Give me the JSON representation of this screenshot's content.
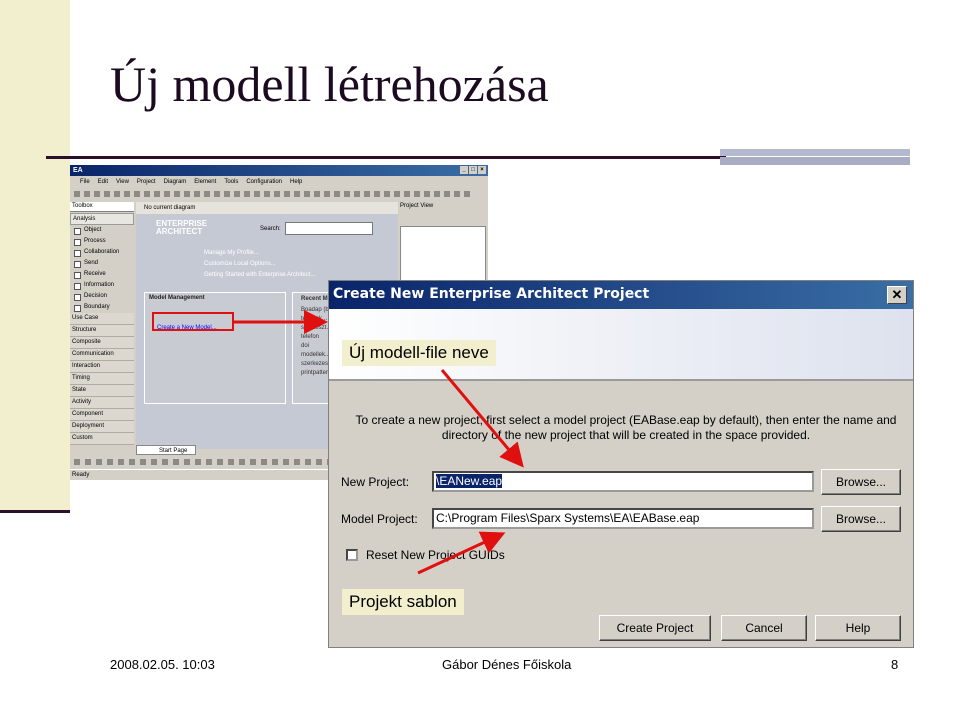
{
  "slide": {
    "title": "Új modell létrehozása",
    "footer_date": "2008.02.05. 10:03",
    "footer_center": "Gábor Dénes Főiskola",
    "page_number": "8",
    "accent_color": "#2b0f2b",
    "callout_color": "#f2efcf",
    "arrow_color": "#e01010"
  },
  "callouts": {
    "file_name": "Új modell-file neve",
    "template": "Projekt sablon"
  },
  "ea_window": {
    "title": "EA",
    "menu": [
      "File",
      "Edit",
      "View",
      "Project",
      "Diagram",
      "Element",
      "Tools",
      "Configuration",
      "Help"
    ],
    "toolbox_header": "Toolbox",
    "toolbox_section": "Analysis",
    "toolbox_items": [
      "Object",
      "Process",
      "Collaboration",
      "Send",
      "Receive",
      "Information",
      "Decision",
      "Boundary"
    ],
    "toolbox_categories": [
      "Use Case",
      "Structure",
      "Composite",
      "Communication",
      "Interaction",
      "Timing",
      "State",
      "Activity",
      "Component",
      "Deployment",
      "Custom"
    ],
    "diagram_tab": "No current diagram",
    "logo_line1": "ENTERPRISE",
    "logo_line2": "ARCHITECT",
    "search_label": "Search:",
    "links": [
      "Manage My Profile...",
      "Customize Local Options...",
      "Getting Started with Enterprise Architect..."
    ],
    "model_management_header": "Model Management",
    "create_new_model": "Create a New Model...",
    "recent_header": "Recent Models",
    "recent_items": [
      "Boadap (b...",
      "telefonk...",
      "szerkeszt...",
      "telefon",
      "doi",
      "modellek...",
      "szerkezes...",
      "printpatter..."
    ],
    "start_page_tab": "Start Page",
    "project_view": "Project View",
    "status": "Ready"
  },
  "dialog": {
    "title": "Create New Enterprise Architect Project",
    "close_glyph": "✕",
    "description": "To create a new project, first select a model project (EABase.eap by default), then enter the name and directory of the new project that will be created in the space provided.",
    "new_project_label": "New Project:",
    "new_project_value": "\\EANew.eap",
    "model_project_label": "Model Project:",
    "model_project_value": "C:\\Program Files\\Sparx Systems\\EA\\EABase.eap",
    "browse": "Browse...",
    "reset_guids_label": "Reset New Project GUIDs",
    "create_button": "Create Project",
    "cancel_button": "Cancel",
    "help_button": "Help"
  }
}
